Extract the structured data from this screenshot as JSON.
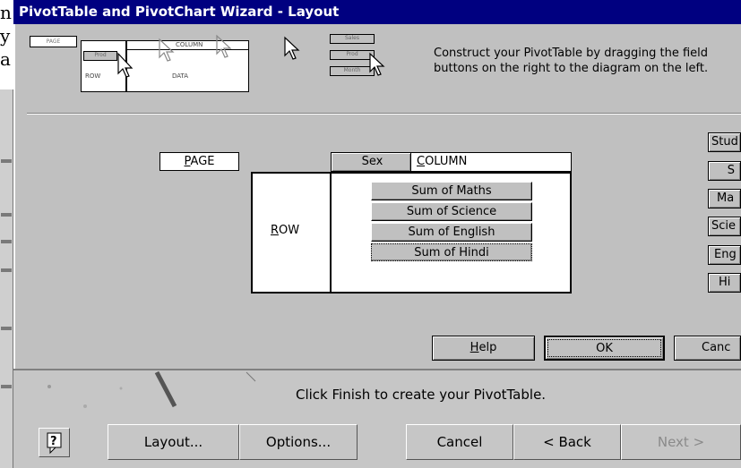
{
  "background": {
    "frag1": "n",
    "frag2": "y",
    "frag3": "a"
  },
  "layout_dialog": {
    "title": "PivotTable and PivotChart Wizard - Layout",
    "thumbnail": {
      "page": "PAGE",
      "column": "COLUMN",
      "row": "ROW",
      "data": "DATA",
      "prod": "Prod",
      "chips": [
        "Sales",
        "Prod",
        "Month"
      ]
    },
    "instructions": "Construct your PivotTable by dragging the field buttons on the right to the diagram on the left.",
    "page_label": "PAGE",
    "page_label_mnemonic": "P",
    "column_field": "Sex",
    "column_label": "COLUMN",
    "column_label_mnemonic": "C",
    "row_label": "ROW",
    "row_label_mnemonic": "R",
    "data_fields": [
      "Sum of Maths",
      "Sum of Science",
      "Sum of English",
      "Sum of Hindi"
    ],
    "field_buttons": [
      "Stud",
      "S",
      "Ma",
      "Scie",
      "Eng",
      "Hi"
    ],
    "help_label": "Help",
    "ok_label": "OK",
    "cancel_label": "Canc"
  },
  "wizard": {
    "message": "Click Finish to create your PivotTable.",
    "buttons": {
      "layout": "Layout...",
      "options": "Options...",
      "cancel": "Cancel",
      "back": "< Back",
      "next": "Next >"
    }
  }
}
